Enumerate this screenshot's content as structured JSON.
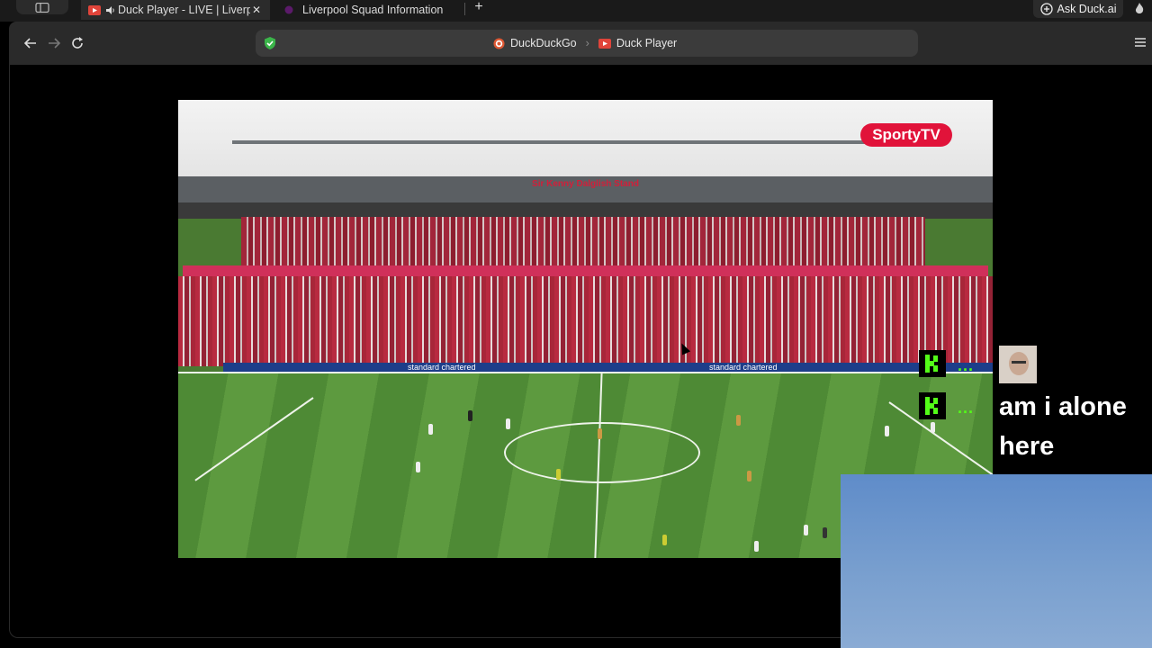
{
  "browser": {
    "tabs": [
      {
        "title": "Duck Player - LIVE | Liverp",
        "active": true,
        "audio": true
      },
      {
        "title": "Liverpool Squad Information",
        "active": false
      }
    ],
    "ask_duck_label": "Ask Duck.ai",
    "address": {
      "crumbs": [
        "DuckDuckGo",
        "Duck Player"
      ]
    }
  },
  "video": {
    "stand_name": "Sir Kenny Dalglish Stand",
    "watermark": "SportyTV",
    "adboard": [
      "standard chartered",
      "standard chartered"
    ]
  },
  "overlay": {
    "chat_message": "am i alone here",
    "kick_dots": "...",
    "colors": {
      "kick_green": "#53fc18",
      "sporty_red": "#e1133a"
    }
  }
}
